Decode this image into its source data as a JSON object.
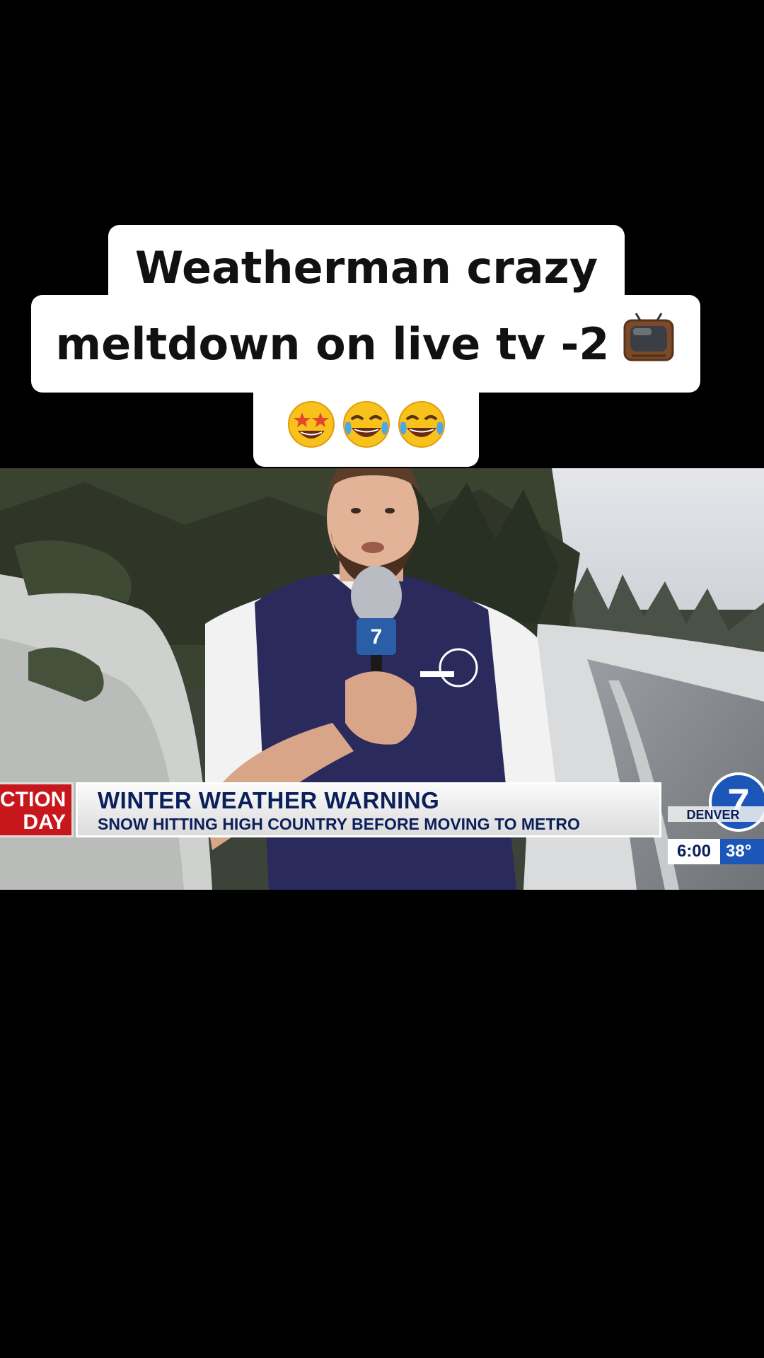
{
  "caption": {
    "line1": "Weatherman crazy",
    "line2": "meltdown on live tv -2",
    "icons": [
      "television-emoji",
      "star-struck-emoji",
      "tears-of-joy-emoji",
      "tears-of-joy-emoji"
    ]
  },
  "broadcast": {
    "tag_line1": "CTION",
    "tag_line2": "DAY",
    "headline": "WINTER WEATHER WARNING",
    "subhead": "SNOW HITTING HIGH COUNTRY BEFORE MOVING TO METRO",
    "station_logo_text": "DENVER",
    "station_number": "7",
    "time": "6:00",
    "temperature": "38°",
    "colors": {
      "tag": "#c8161d",
      "navy": "#0b1f5a",
      "logo_blue": "#1c56b8"
    }
  }
}
